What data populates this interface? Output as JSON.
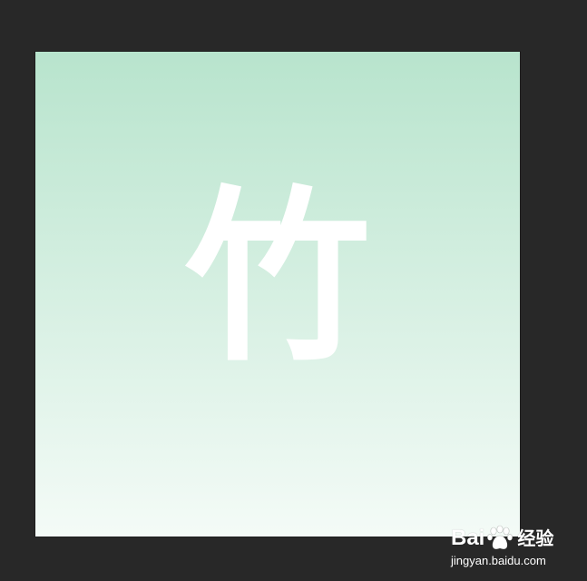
{
  "workspace": {
    "background_color": "#282828"
  },
  "canvas": {
    "glyph": "竹",
    "glyph_color": "#ffffff",
    "gradient_top": "#b8e4cd",
    "gradient_bottom": "#f4fbf7"
  },
  "watermark": {
    "brand_left": "Bai",
    "brand_right": "经验",
    "paw_icon": "baidu-paw-icon",
    "url": "jingyan.baidu.com"
  }
}
